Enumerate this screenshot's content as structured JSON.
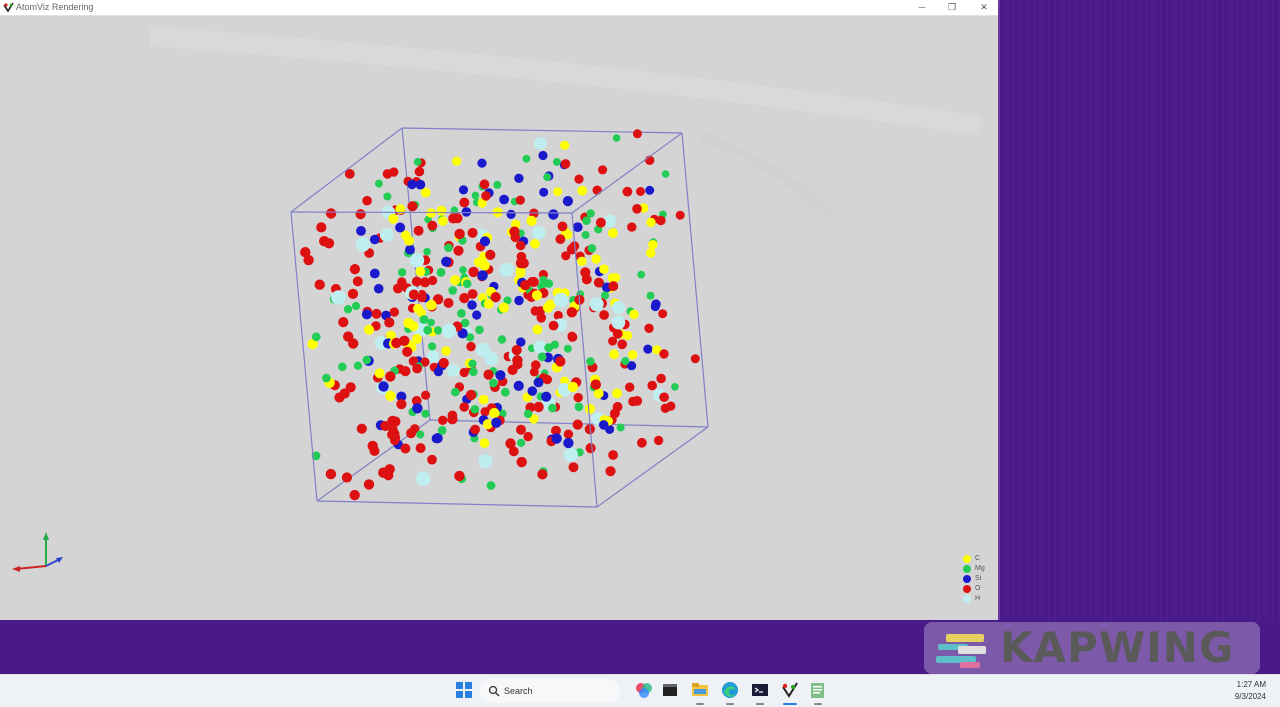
{
  "window": {
    "title": "AtomViz Rendering",
    "controls": {
      "minimize": "─",
      "maximize": "❐",
      "close": "✕"
    }
  },
  "legend": {
    "items": [
      {
        "label": "C",
        "color": "#ffff00"
      },
      {
        "label": "Mg",
        "color": "#22cc55"
      },
      {
        "label": "Si",
        "color": "#1a1acc"
      },
      {
        "label": "O",
        "color": "#dd1111"
      },
      {
        "label": "H",
        "color": "#bfeef0"
      }
    ]
  },
  "box": {
    "edge_color": "#8080c8"
  },
  "watermark": {
    "text": "KAPWING"
  },
  "taskbar": {
    "search_placeholder": "Search",
    "time": "1:27 AM",
    "date": "9/3/2024",
    "icons": [
      "start-icon",
      "photos-icon",
      "terminal-icon",
      "file-explorer-icon",
      "edge-icon",
      "command-prompt-icon",
      "atomviz-icon",
      "notepad-icon"
    ]
  }
}
